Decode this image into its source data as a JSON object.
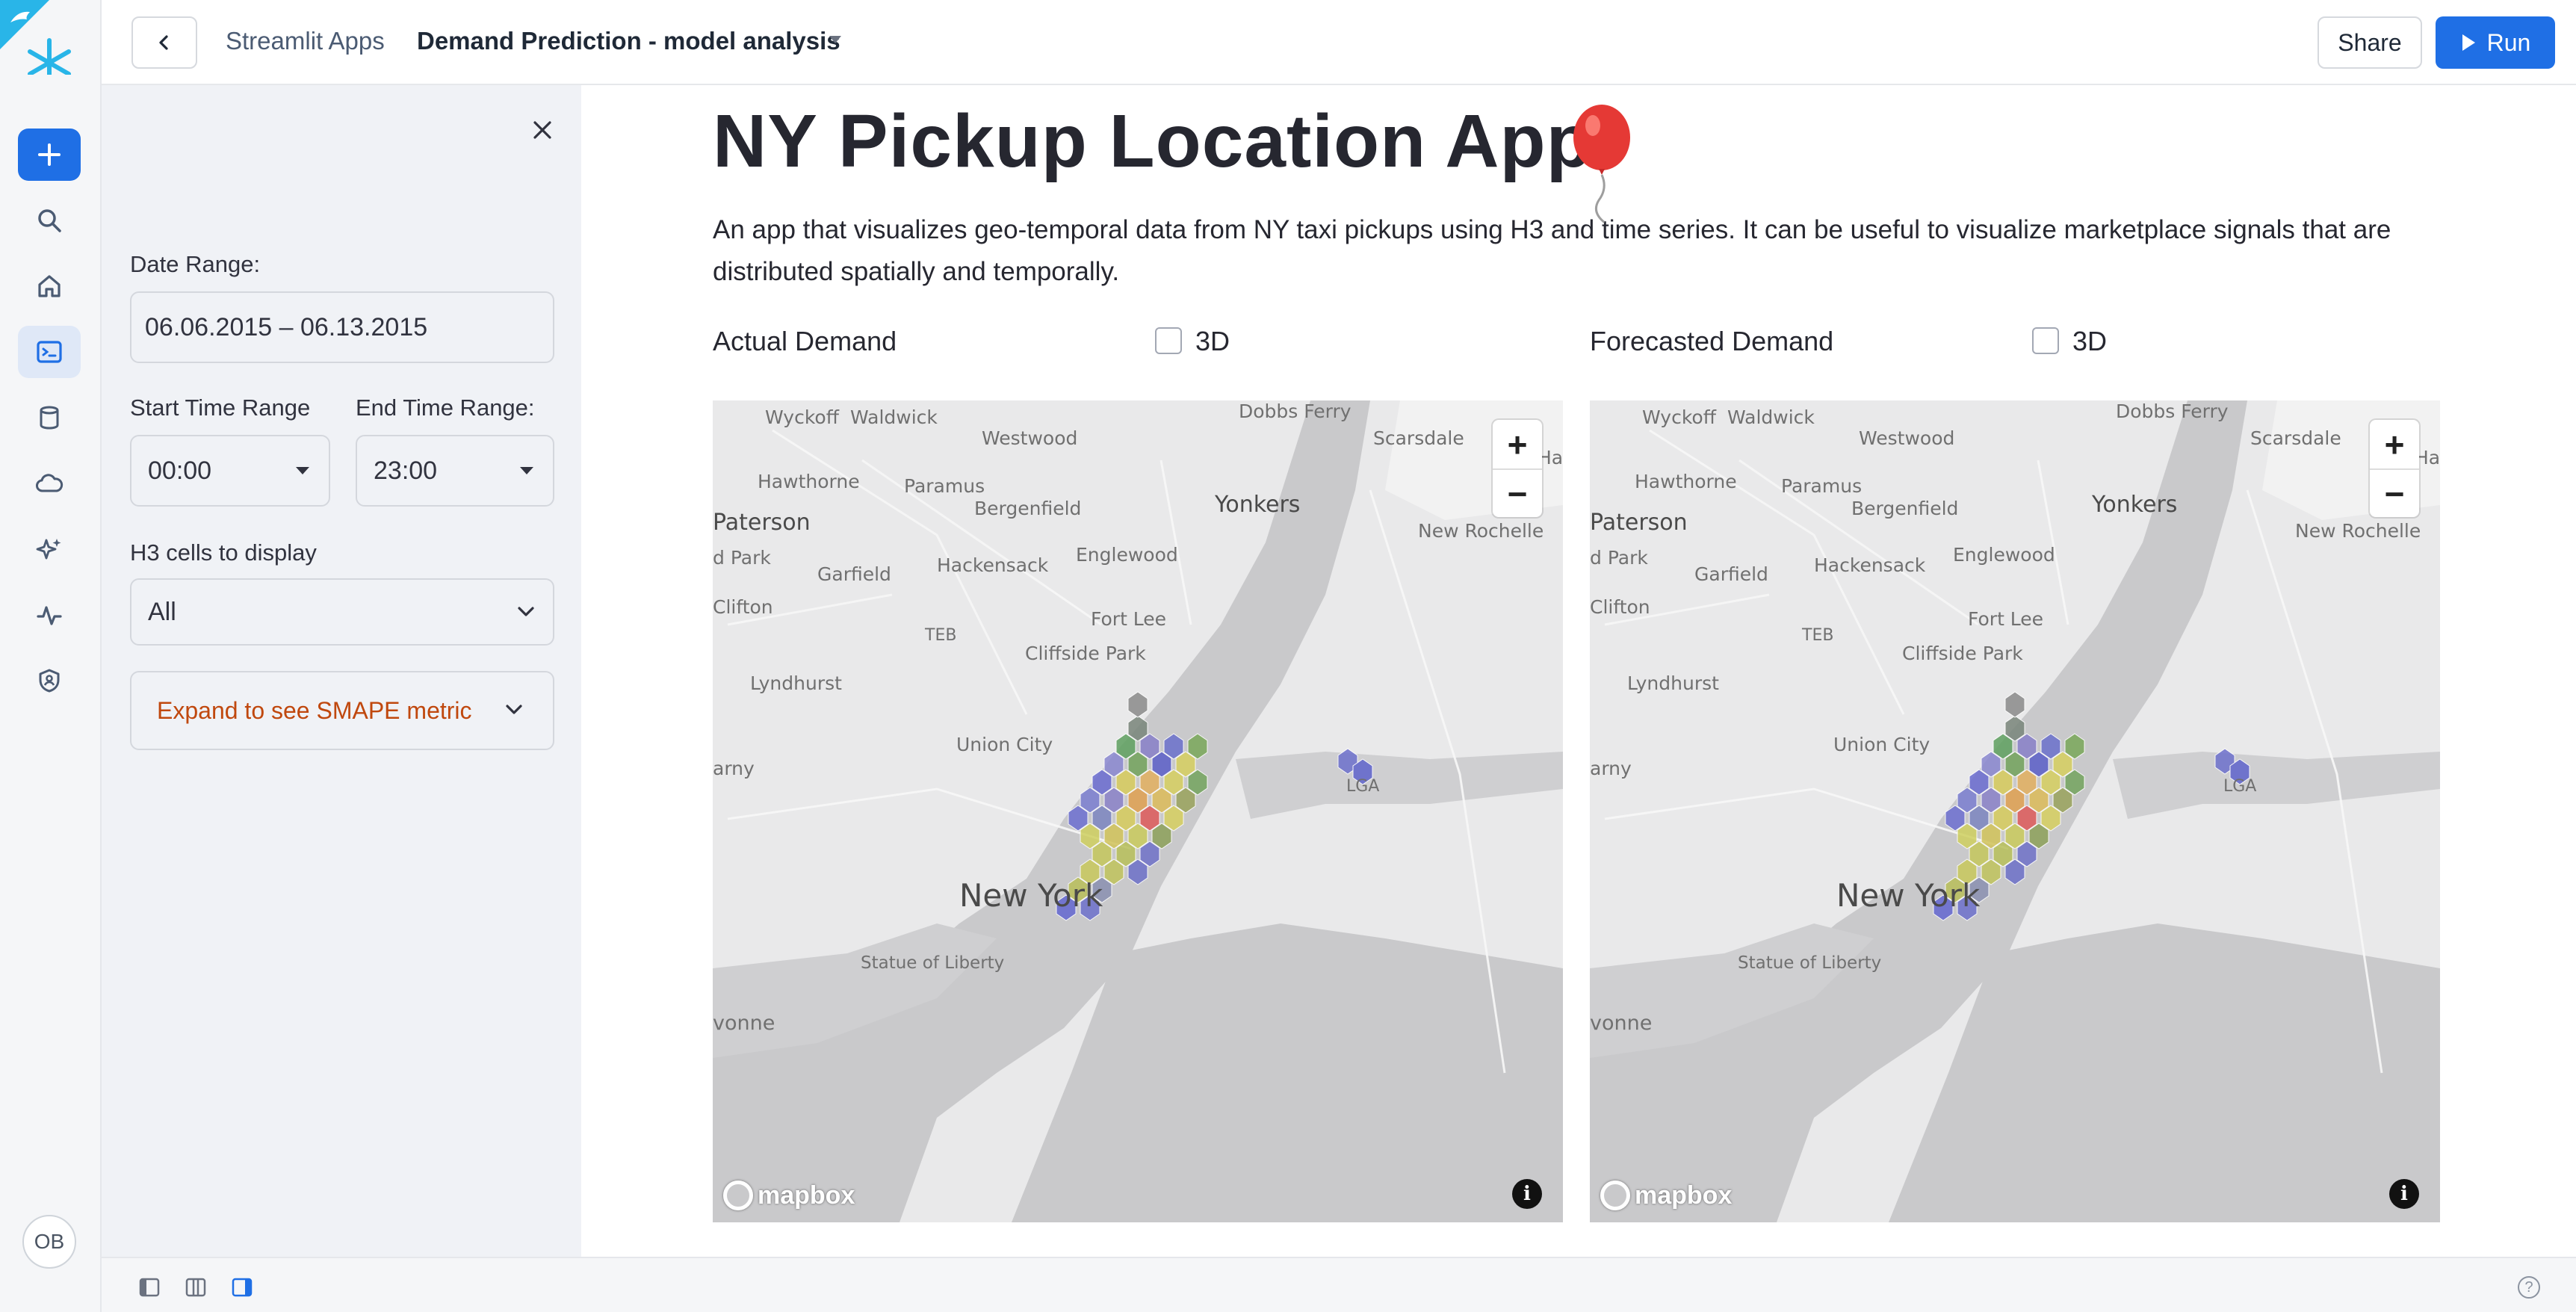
{
  "topbar": {
    "breadcrumb_apps": "Streamlit Apps",
    "app_name": "Demand Prediction - model analysis",
    "share_label": "Share",
    "run_label": "Run"
  },
  "rail": {
    "avatar_initials": "OB",
    "accent_color": "#1f6fe5",
    "items": [
      "plus-icon",
      "search-icon",
      "home-icon",
      "streamlit-icon",
      "database-icon",
      "cloud-icon",
      "sparkle-icon",
      "activity-icon",
      "shield-icon"
    ]
  },
  "sidebar": {
    "date_range_label": "Date Range:",
    "date_range_value": "06.06.2015 – 06.13.2015",
    "start_time_label": "Start Time Range",
    "start_time_value": "00:00",
    "end_time_label": "End Time Range:",
    "end_time_value": "23:00",
    "h3_label": "H3 cells to display",
    "h3_value": "All",
    "expander_label": "Expand to see SMAPE metric"
  },
  "main": {
    "title": "NY Pickup Location App",
    "title_emoji": "balloon",
    "description": "An app that visualizes geo-temporal data from NY taxi pickups using H3 and time series. It can be useful to visualize marketplace signals that are distributed spatially and temporally.",
    "actual": {
      "label": "Actual Demand",
      "checkbox_label": "3D",
      "checked": false
    },
    "forecast": {
      "label": "Forecasted Demand",
      "checkbox_label": "3D",
      "checked": false
    }
  },
  "map": {
    "attribution": "mapbox",
    "labels": {
      "wyckoff": "Wyckoff",
      "waldwick": "Waldwick",
      "dobbs_ferry": "Dobbs Ferry",
      "westwood": "Westwood",
      "scarsdale": "Scarsdale",
      "har": "Har",
      "hawthorne": "Hawthorne",
      "paramus": "Paramus",
      "yonkers": "Yonkers",
      "paterson": "Paterson",
      "bergenfield": "Bergenfield",
      "new_rochelle": "New Rochelle",
      "d_park": "d Park",
      "garfield": "Garfield",
      "hackensack": "Hackensack",
      "englewood": "Englewood",
      "clifton": "Clifton",
      "teb": "TEB",
      "fort_lee": "Fort Lee",
      "cliffside_park": "Cliffside Park",
      "lyndhurst": "Lyndhurst",
      "union_city": "Union City",
      "arny": "arny",
      "lga": "LGA",
      "new_york": "New York",
      "statue_of_liberty": "Statue of Liberty",
      "vonne": "vonne"
    }
  }
}
